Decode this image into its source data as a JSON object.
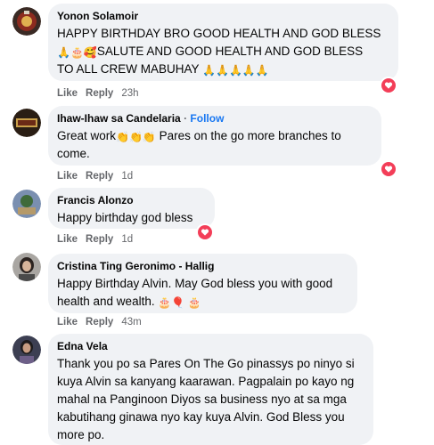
{
  "comments": [
    {
      "author": "Yonon Solamoir",
      "lines": [
        "HAPPY BIRTHDAY BRO GOOD HEALTH AND GOD BLESS",
        "SALUTE AND GOOD HEALTH AND GOD BLESS",
        "TO ALL CREW MABUHAY"
      ],
      "line2_prefix": "🙏🎂🥰",
      "line3_suffix": "🙏🙏🙏🙏🙏",
      "like": "Like",
      "reply": "Reply",
      "time": "23h"
    },
    {
      "author": "Ihaw-Ihaw sa Candelaria",
      "follow_sep": "·",
      "follow": "Follow",
      "line1_start": "Great work",
      "line1_emoji": "👏👏👏",
      "line1_end": " Pares on the go more branches to",
      "line2": "come.",
      "like": "Like",
      "reply": "Reply",
      "time": "1d"
    },
    {
      "author": "Francis Alonzo",
      "lines": [
        "Happy birthday god bless"
      ],
      "like": "Like",
      "reply": "Reply",
      "time": "1d"
    },
    {
      "author": "Cristina Ting Geronimo - Hallig",
      "lines": [
        "Happy Birthday Alvin. May God bless you with good",
        "health and wealth."
      ],
      "line2_suffix": "🎂🎈 🎂",
      "like": "Like",
      "reply": "Reply",
      "time": "43m"
    },
    {
      "author": "Edna Vela",
      "lines": [
        "Thank you po sa Pares On The Go pinassys po ninyo si",
        "kuya Alvin sa kanyang kaarawan. Pagpalain po kayo ng",
        "mahal na Panginoon Diyos sa business nyo at sa mga",
        "kabutihang ginawa nyo kay kuya Alvin. God Bless you",
        "more po."
      ]
    }
  ],
  "colors": {
    "bubble": "#f0f2f5",
    "link": "#1877f2",
    "meta": "#65676b",
    "heart": "#f33e58"
  },
  "icons": {
    "reaction": "heart-icon"
  }
}
